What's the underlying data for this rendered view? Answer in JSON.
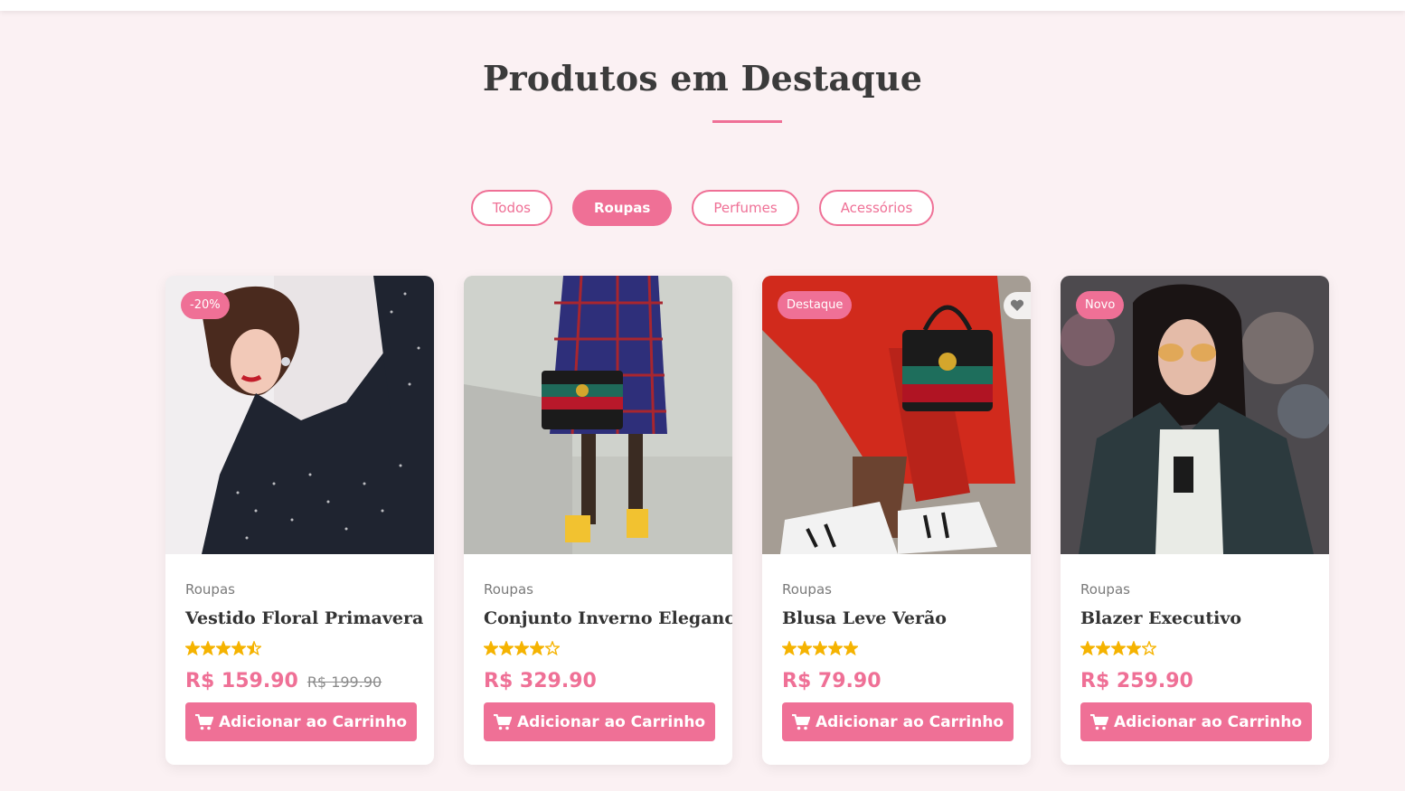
{
  "section": {
    "title": "Produtos em Destaque"
  },
  "filters": [
    {
      "label": "Todos",
      "active": false
    },
    {
      "label": "Roupas",
      "active": true
    },
    {
      "label": "Perfumes",
      "active": false
    },
    {
      "label": "Acessórios",
      "active": false
    }
  ],
  "colors": {
    "accent": "#ef7096",
    "background": "#fbf1f3",
    "star": "#f5b301"
  },
  "products": [
    {
      "badge": "-20%",
      "category": "Roupas",
      "name": "Vestido Floral Primavera",
      "rating": 4.5,
      "price": "R$ 159.90",
      "old_price": "R$ 199.90",
      "cart_label": "Adicionar ao Carrinho",
      "image": "woman in polka dot blouse"
    },
    {
      "badge": "",
      "category": "Roupas",
      "name": "Conjunto Inverno Elegance",
      "rating": 4,
      "price": "R$ 329.90",
      "old_price": "",
      "cart_label": "Adicionar ao Carrinho",
      "image": "plaid skirt and handbag"
    },
    {
      "badge": "Destaque",
      "category": "Roupas",
      "name": "Blusa Leve Verão",
      "rating": 5,
      "price": "R$ 79.90",
      "old_price": "",
      "cart_label": "Adicionar ao Carrinho",
      "image": "red skirt and black handbag",
      "wishlist_icon": "heart-icon"
    },
    {
      "badge": "Novo",
      "category": "Roupas",
      "name": "Blazer Executivo",
      "rating": 4,
      "price": "R$ 259.90",
      "old_price": "",
      "cart_label": "Adicionar ao Carrinho",
      "image": "woman in denim jacket with sunglasses"
    }
  ]
}
